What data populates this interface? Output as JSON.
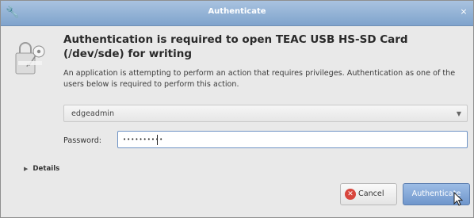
{
  "window": {
    "title": "Authenticate",
    "close_glyph": "×",
    "title_icon": "🔧"
  },
  "dialog": {
    "heading": "Authentication is required to open TEAC USB   HS-SD Card (/dev/sde) for writing",
    "description": "An application is attempting to perform an action that requires privileges. Authentication as one of the users below is required to perform this action.",
    "user_select": {
      "value": "edgeadmin",
      "arrow_glyph": "▼"
    },
    "password": {
      "label": "Password:",
      "masked_value": "••••••••••"
    },
    "details_label": "Details",
    "details_glyph": "▶",
    "buttons": {
      "cancel": "Cancel",
      "authenticate": "Authenticate"
    },
    "icons": {
      "cancel_glyph": "✕"
    }
  },
  "colors": {
    "titlebar": "#7fa3cc",
    "accent": "#6e93c5",
    "cancel_red": "#d8463d"
  }
}
